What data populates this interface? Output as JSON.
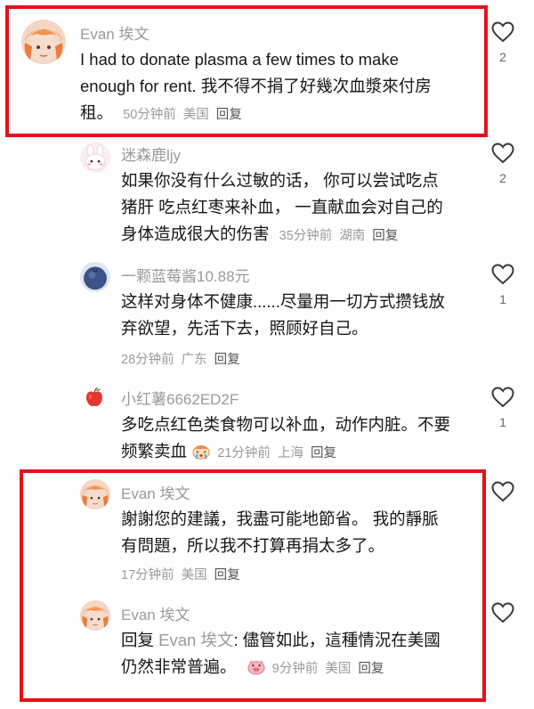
{
  "comments": [
    {
      "author": "Evan 埃文",
      "lines": [
        "I had to donate plasma a few times to make",
        "enough for rent. 我不得不捐了好幾次血漿來付房",
        "租。"
      ],
      "time": "50分钟前",
      "region": "美国",
      "reply": "回复",
      "likes": "2",
      "avatar_icon": "orange-hair-avatar-icon"
    },
    {
      "author": "迷森鹿ljy",
      "lines": [
        "如果你没有什么过敏的话， 你可以尝试吃点",
        "猪肝 吃点红枣来补血， 一直献血会对自己的",
        "身体造成很大的伤害"
      ],
      "time": "35分钟前",
      "region": "湖南",
      "reply": "回复",
      "likes": "2",
      "avatar_icon": "pink-bunny-avatar-icon"
    },
    {
      "author": "一颗蓝莓酱10.88元",
      "lines": [
        "这样对身体不健康......尽量用一切方式攒钱放",
        "弃欲望，先活下去，照顾好自己。"
      ],
      "time": "28分钟前",
      "region": "广东",
      "reply": "回复",
      "likes": "1",
      "avatar_icon": "blueberry-avatar-icon"
    },
    {
      "author": "小红薯6662ED2F",
      "lines": [
        "多吃点红色类食物可以补血，动作内脏。不要",
        "频繁卖血"
      ],
      "time": "21分钟前",
      "region": "上海",
      "reply": "回复",
      "likes": "1",
      "avatar_icon": "apple-avatar-icon",
      "sticker": "crying-sticker-icon"
    },
    {
      "author": "Evan 埃文",
      "lines": [
        "謝謝您的建議，我盡可能地節省。 我的靜脈",
        "有問題，所以我不打算再捐太多了。"
      ],
      "time": "17分钟前",
      "region": "美国",
      "reply": "回复",
      "likes": "",
      "avatar_icon": "orange-hair-avatar-icon"
    },
    {
      "author": "Evan 埃文",
      "reply_prefix": "回复",
      "reply_to": "Evan 埃文",
      "line1_rest": ": 儘管如此，這種情況在美國",
      "line2": "仍然非常普遍。",
      "time": "9分钟前",
      "region": "美国",
      "reply": "回复",
      "likes": "",
      "avatar_icon": "orange-hair-avatar-icon",
      "sticker": "pig-sticker-icon"
    }
  ]
}
